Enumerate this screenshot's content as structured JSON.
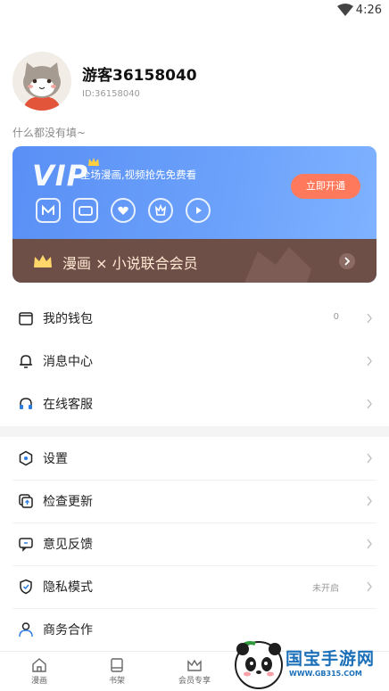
{
  "status_bar": {
    "time": "4:26",
    "wifi_icon": "wifi-icon"
  },
  "profile": {
    "name": "游客36158040",
    "id_text": "ID:36158040",
    "bio": "什么都没有填~",
    "avatar_icon": "cat-avatar-icon"
  },
  "vip": {
    "logo": "VIP",
    "tagline": "全场漫画,视频抢先免费看",
    "open_button": "立即开通",
    "benefit_icons": [
      "manga-benefit-icon",
      "video-benefit-icon",
      "heart-benefit-icon",
      "bag-benefit-icon",
      "play-benefit-icon"
    ],
    "joint_text": "漫画 × 小说联合会员",
    "accent_color": "#5a8ff5",
    "button_color": "#ff7a5c",
    "banner_color": "#6e4f48"
  },
  "menu": {
    "wallet": {
      "label": "我的钱包",
      "value": "0"
    },
    "messages": {
      "label": "消息中心"
    },
    "support": {
      "label": "在线客服"
    },
    "settings": {
      "label": "设置"
    },
    "update": {
      "label": "检查更新"
    },
    "feedback": {
      "label": "意见反馈"
    },
    "privacy": {
      "label": "隐私模式",
      "value": "未开启"
    },
    "business": {
      "label": "商务合作"
    }
  },
  "bottom_nav": [
    {
      "label": "漫画",
      "icon": "home-icon"
    },
    {
      "label": "书架",
      "icon": "book-icon"
    },
    {
      "label": "会员专享",
      "icon": "crown-icon"
    }
  ],
  "watermark": {
    "title": "国宝手游网",
    "url": "WWW.GB315.COM"
  }
}
